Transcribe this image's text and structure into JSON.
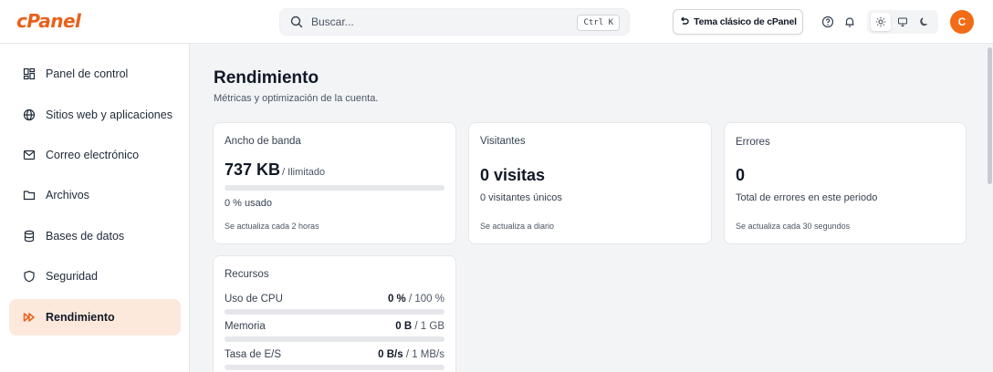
{
  "brand": {
    "logo": "cPanel",
    "color": "#e8611a"
  },
  "topbar": {
    "search_placeholder": "Buscar...",
    "search_shortcut": "Ctrl K",
    "classic_theme_label": "Tema clásico de cPanel",
    "avatar_initial": "C",
    "icons": [
      "search-icon",
      "undo-icon",
      "help-icon",
      "bell-icon",
      "sun-icon",
      "monitor-icon",
      "moon-icon"
    ]
  },
  "sidebar": {
    "items": [
      {
        "label": "Panel de control",
        "icon": "dashboard-icon"
      },
      {
        "label": "Sitios web y aplicaciones",
        "icon": "globe-icon"
      },
      {
        "label": "Correo electrónico",
        "icon": "mail-icon"
      },
      {
        "label": "Archivos",
        "icon": "folder-icon"
      },
      {
        "label": "Bases de datos",
        "icon": "database-icon"
      },
      {
        "label": "Seguridad",
        "icon": "shield-icon"
      },
      {
        "label": "Rendimiento",
        "icon": "fast-forward-icon",
        "active": true
      }
    ]
  },
  "page": {
    "title": "Rendimiento",
    "subtitle": "Métricas y optimización de la cuenta."
  },
  "cards": {
    "bandwidth": {
      "title": "Ancho de banda",
      "value": "737 KB",
      "limit": "/ Ilimitado",
      "usage": "0 % usado",
      "usage_fraction": 0,
      "footer": "Se actualiza cada 2 horas"
    },
    "visitors": {
      "title": "Visitantes",
      "value": "0 visitas",
      "detail": "0 visitantes únicos",
      "footer": "Se actualiza a diario"
    },
    "errors": {
      "title": "Errores",
      "value": "0",
      "detail": "Total de errores en este periodo",
      "footer": "Se actualiza cada 30 segundos"
    },
    "resources": {
      "title": "Recursos",
      "rows": [
        {
          "label": "Uso de CPU",
          "value": "0 %",
          "limit": "/ 100 %",
          "fraction": 0
        },
        {
          "label": "Memoria",
          "value": "0 B",
          "limit": "/ 1 GB",
          "fraction": 0
        },
        {
          "label": "Tasa de E/S",
          "value": "0 B/s",
          "limit": "/ 1 MB/s",
          "fraction": 0
        }
      ]
    }
  },
  "colors": {
    "accent": "#f26b16",
    "active_nav_bg": "#fde9dc"
  }
}
